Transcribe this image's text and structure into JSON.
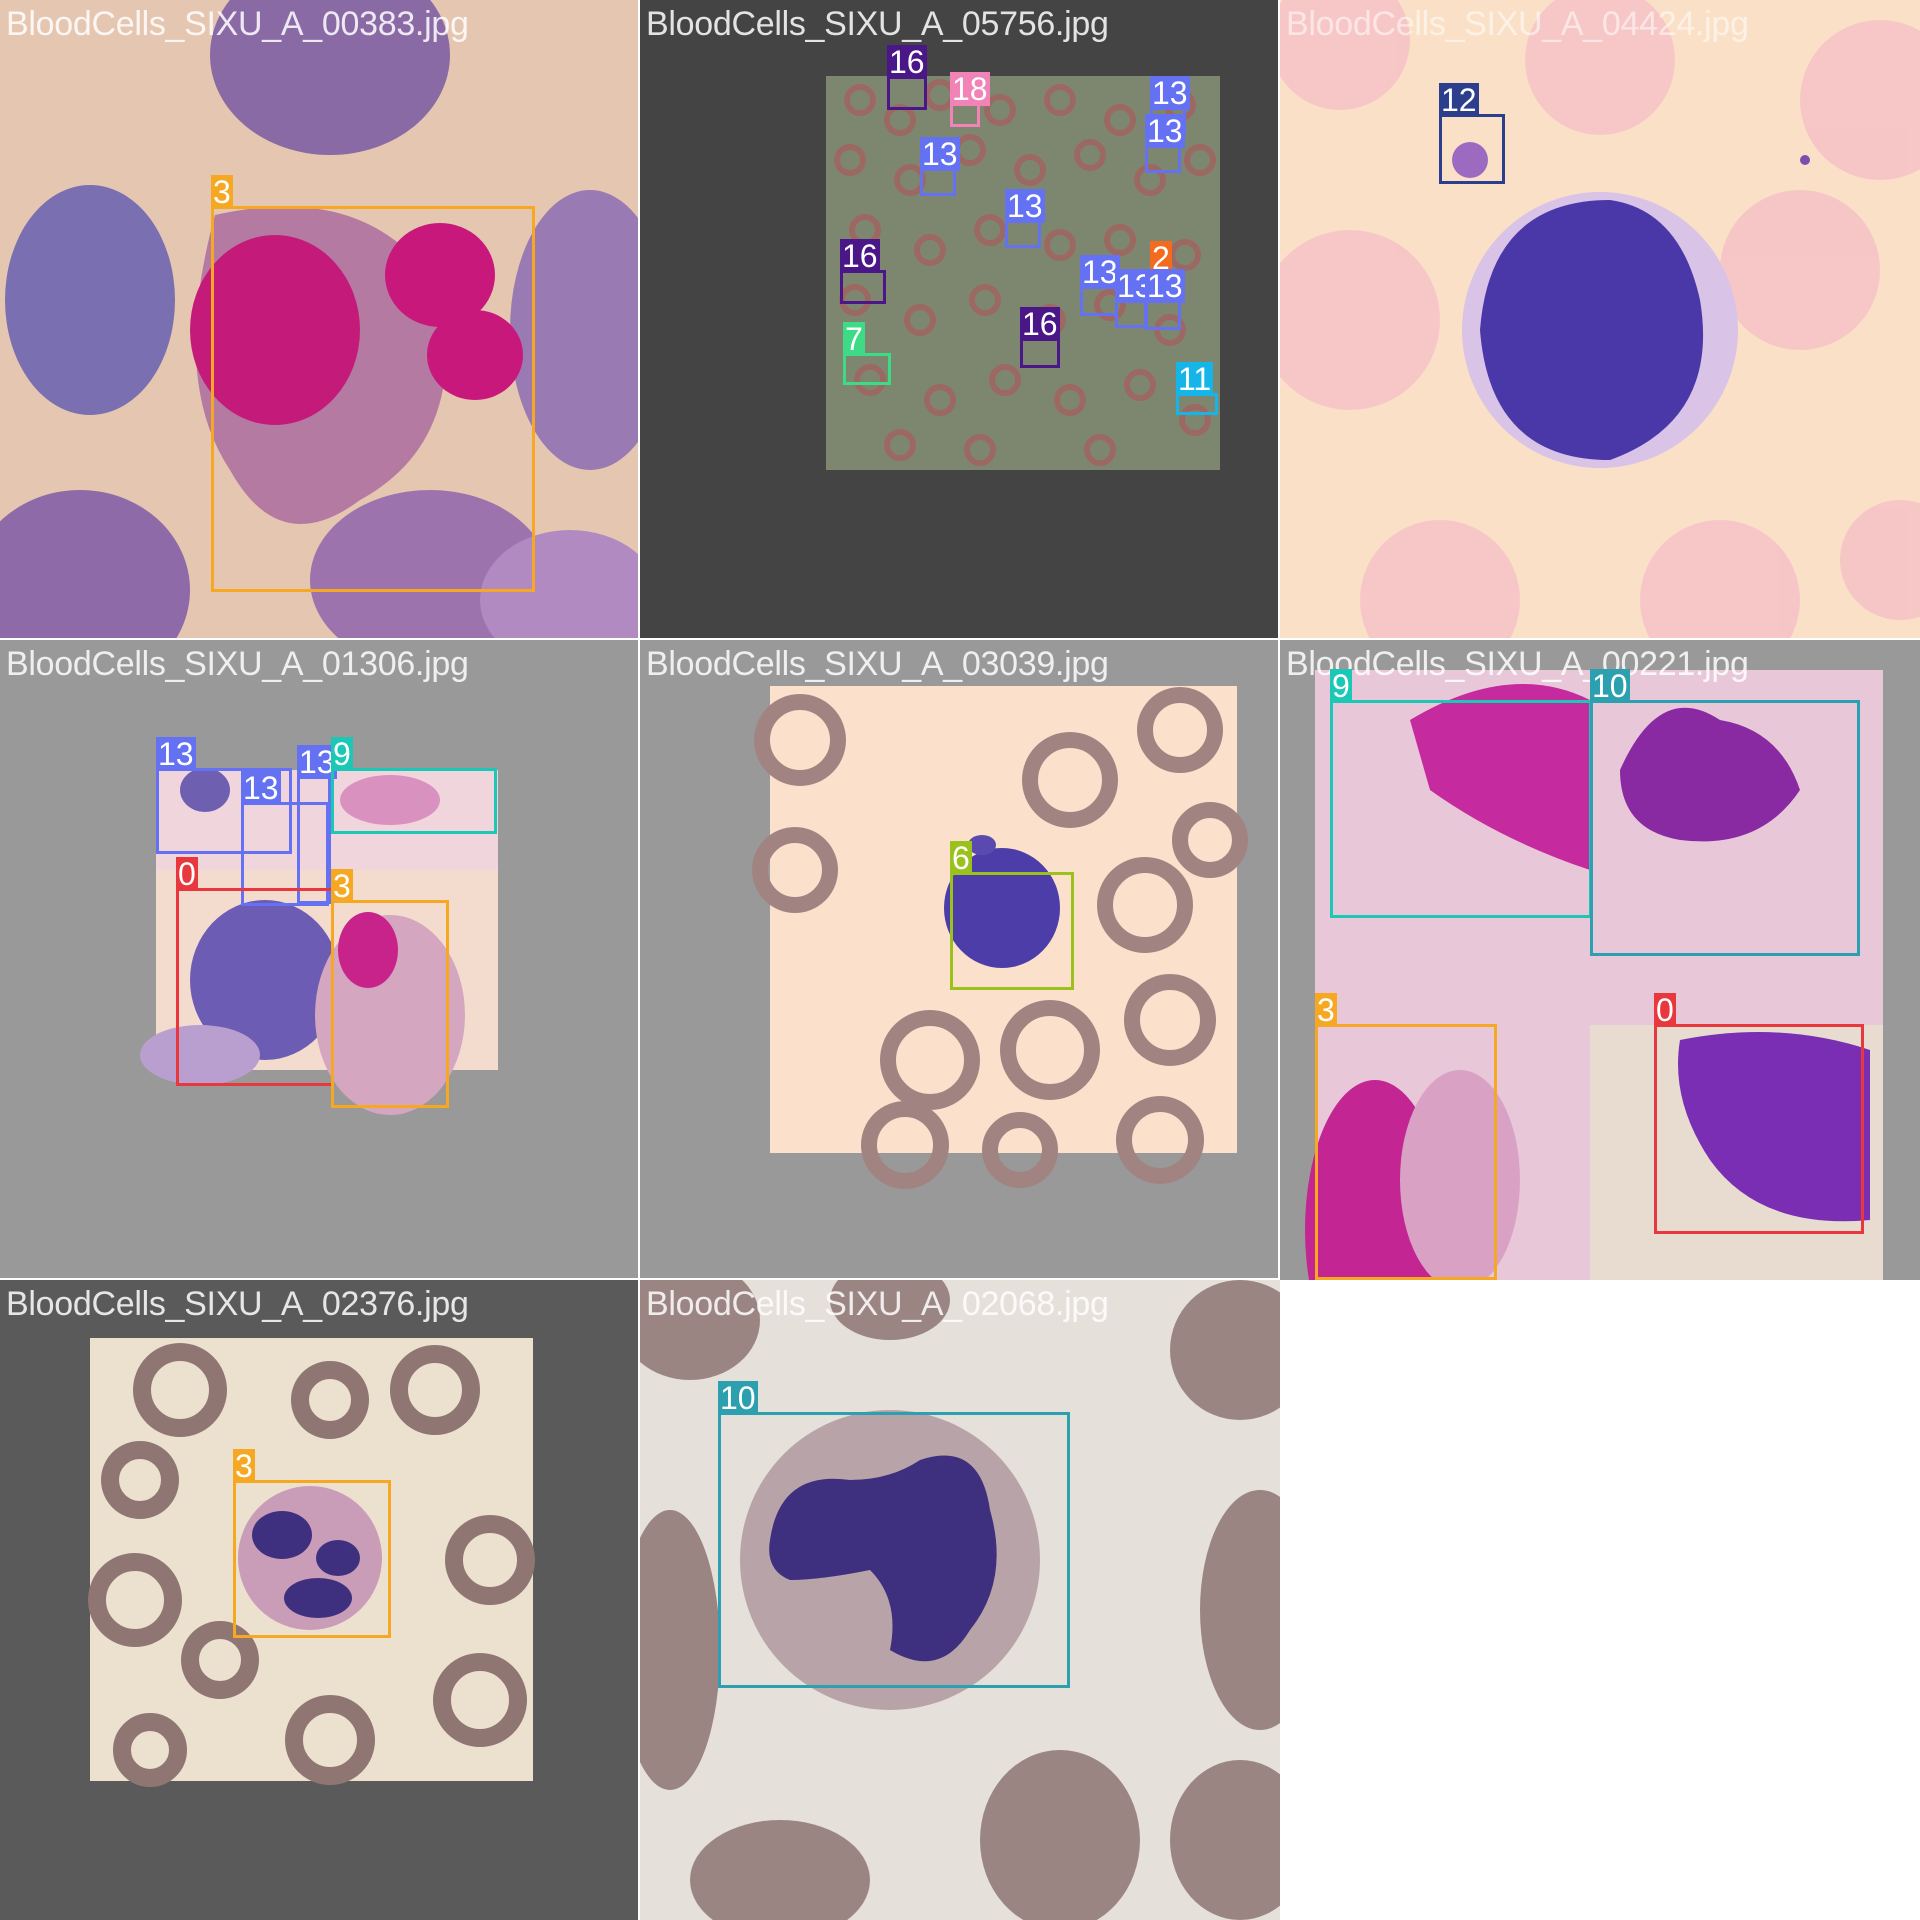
{
  "tiles": [
    {
      "filename": "BloodCells_SIXU_A_00383.jpg",
      "labels": [
        "3"
      ]
    },
    {
      "filename": "BloodCells_SIXU_A_05756.jpg",
      "labels": [
        "16",
        "18",
        "13",
        "13",
        "13",
        "13",
        "16",
        "13",
        "2",
        "13",
        "13",
        "13",
        "7",
        "16",
        "11"
      ]
    },
    {
      "filename": "BloodCells_SIXU_A_04424.jpg",
      "labels": [
        "12"
      ]
    },
    {
      "filename": "BloodCells_SIXU_A_01306.jpg",
      "labels": [
        "13",
        "13",
        "9",
        "13",
        "0",
        "3"
      ]
    },
    {
      "filename": "BloodCells_SIXU_A_03039.jpg",
      "labels": [
        "6"
      ]
    },
    {
      "filename": "BloodCells_SIXU_A_00221.jpg",
      "labels": [
        "9",
        "10",
        "3",
        "0"
      ]
    },
    {
      "filename": "BloodCells_SIXU_A_02376.jpg",
      "labels": [
        "3"
      ]
    },
    {
      "filename": "BloodCells_SIXU_A_02068.jpg",
      "labels": [
        "10"
      ]
    }
  ],
  "class_colors": {
    "0": "#e8383d",
    "2": "#f26b1f",
    "3": "#f7a823",
    "6": "#9ac21b",
    "7": "#3ddb86",
    "9": "#1ac8b5",
    "10": "#2ca0ae",
    "11": "#15b5ea",
    "12": "#2b3f8c",
    "13": "#6471f2",
    "16": "#4b1687",
    "18": "#f283b6"
  }
}
